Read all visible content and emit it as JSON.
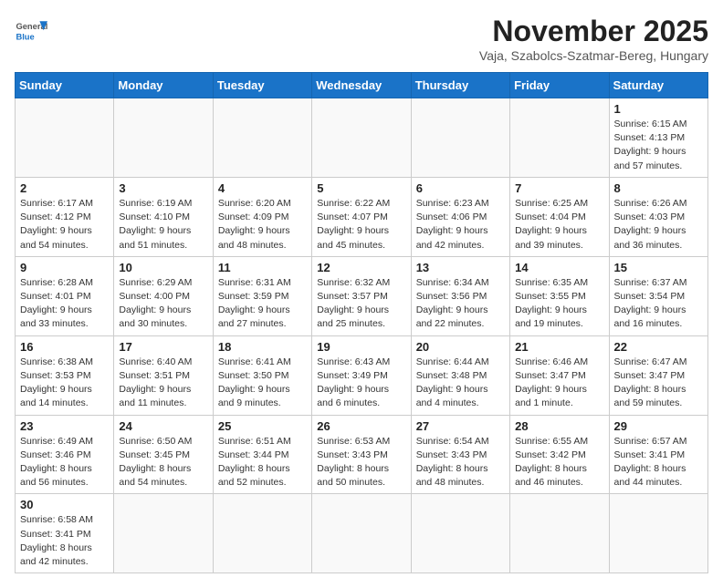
{
  "header": {
    "logo_general": "General",
    "logo_blue": "Blue",
    "month_title": "November 2025",
    "location": "Vaja, Szabolcs-Szatmar-Bereg, Hungary"
  },
  "weekdays": [
    "Sunday",
    "Monday",
    "Tuesday",
    "Wednesday",
    "Thursday",
    "Friday",
    "Saturday"
  ],
  "weeks": [
    [
      {
        "day": "",
        "info": ""
      },
      {
        "day": "",
        "info": ""
      },
      {
        "day": "",
        "info": ""
      },
      {
        "day": "",
        "info": ""
      },
      {
        "day": "",
        "info": ""
      },
      {
        "day": "",
        "info": ""
      },
      {
        "day": "1",
        "info": "Sunrise: 6:15 AM\nSunset: 4:13 PM\nDaylight: 9 hours\nand 57 minutes."
      }
    ],
    [
      {
        "day": "2",
        "info": "Sunrise: 6:17 AM\nSunset: 4:12 PM\nDaylight: 9 hours\nand 54 minutes."
      },
      {
        "day": "3",
        "info": "Sunrise: 6:19 AM\nSunset: 4:10 PM\nDaylight: 9 hours\nand 51 minutes."
      },
      {
        "day": "4",
        "info": "Sunrise: 6:20 AM\nSunset: 4:09 PM\nDaylight: 9 hours\nand 48 minutes."
      },
      {
        "day": "5",
        "info": "Sunrise: 6:22 AM\nSunset: 4:07 PM\nDaylight: 9 hours\nand 45 minutes."
      },
      {
        "day": "6",
        "info": "Sunrise: 6:23 AM\nSunset: 4:06 PM\nDaylight: 9 hours\nand 42 minutes."
      },
      {
        "day": "7",
        "info": "Sunrise: 6:25 AM\nSunset: 4:04 PM\nDaylight: 9 hours\nand 39 minutes."
      },
      {
        "day": "8",
        "info": "Sunrise: 6:26 AM\nSunset: 4:03 PM\nDaylight: 9 hours\nand 36 minutes."
      }
    ],
    [
      {
        "day": "9",
        "info": "Sunrise: 6:28 AM\nSunset: 4:01 PM\nDaylight: 9 hours\nand 33 minutes."
      },
      {
        "day": "10",
        "info": "Sunrise: 6:29 AM\nSunset: 4:00 PM\nDaylight: 9 hours\nand 30 minutes."
      },
      {
        "day": "11",
        "info": "Sunrise: 6:31 AM\nSunset: 3:59 PM\nDaylight: 9 hours\nand 27 minutes."
      },
      {
        "day": "12",
        "info": "Sunrise: 6:32 AM\nSunset: 3:57 PM\nDaylight: 9 hours\nand 25 minutes."
      },
      {
        "day": "13",
        "info": "Sunrise: 6:34 AM\nSunset: 3:56 PM\nDaylight: 9 hours\nand 22 minutes."
      },
      {
        "day": "14",
        "info": "Sunrise: 6:35 AM\nSunset: 3:55 PM\nDaylight: 9 hours\nand 19 minutes."
      },
      {
        "day": "15",
        "info": "Sunrise: 6:37 AM\nSunset: 3:54 PM\nDaylight: 9 hours\nand 16 minutes."
      }
    ],
    [
      {
        "day": "16",
        "info": "Sunrise: 6:38 AM\nSunset: 3:53 PM\nDaylight: 9 hours\nand 14 minutes."
      },
      {
        "day": "17",
        "info": "Sunrise: 6:40 AM\nSunset: 3:51 PM\nDaylight: 9 hours\nand 11 minutes."
      },
      {
        "day": "18",
        "info": "Sunrise: 6:41 AM\nSunset: 3:50 PM\nDaylight: 9 hours\nand 9 minutes."
      },
      {
        "day": "19",
        "info": "Sunrise: 6:43 AM\nSunset: 3:49 PM\nDaylight: 9 hours\nand 6 minutes."
      },
      {
        "day": "20",
        "info": "Sunrise: 6:44 AM\nSunset: 3:48 PM\nDaylight: 9 hours\nand 4 minutes."
      },
      {
        "day": "21",
        "info": "Sunrise: 6:46 AM\nSunset: 3:47 PM\nDaylight: 9 hours\nand 1 minute."
      },
      {
        "day": "22",
        "info": "Sunrise: 6:47 AM\nSunset: 3:47 PM\nDaylight: 8 hours\nand 59 minutes."
      }
    ],
    [
      {
        "day": "23",
        "info": "Sunrise: 6:49 AM\nSunset: 3:46 PM\nDaylight: 8 hours\nand 56 minutes."
      },
      {
        "day": "24",
        "info": "Sunrise: 6:50 AM\nSunset: 3:45 PM\nDaylight: 8 hours\nand 54 minutes."
      },
      {
        "day": "25",
        "info": "Sunrise: 6:51 AM\nSunset: 3:44 PM\nDaylight: 8 hours\nand 52 minutes."
      },
      {
        "day": "26",
        "info": "Sunrise: 6:53 AM\nSunset: 3:43 PM\nDaylight: 8 hours\nand 50 minutes."
      },
      {
        "day": "27",
        "info": "Sunrise: 6:54 AM\nSunset: 3:43 PM\nDaylight: 8 hours\nand 48 minutes."
      },
      {
        "day": "28",
        "info": "Sunrise: 6:55 AM\nSunset: 3:42 PM\nDaylight: 8 hours\nand 46 minutes."
      },
      {
        "day": "29",
        "info": "Sunrise: 6:57 AM\nSunset: 3:41 PM\nDaylight: 8 hours\nand 44 minutes."
      }
    ],
    [
      {
        "day": "30",
        "info": "Sunrise: 6:58 AM\nSunset: 3:41 PM\nDaylight: 8 hours\nand 42 minutes."
      },
      {
        "day": "",
        "info": ""
      },
      {
        "day": "",
        "info": ""
      },
      {
        "day": "",
        "info": ""
      },
      {
        "day": "",
        "info": ""
      },
      {
        "day": "",
        "info": ""
      },
      {
        "day": "",
        "info": ""
      }
    ]
  ]
}
